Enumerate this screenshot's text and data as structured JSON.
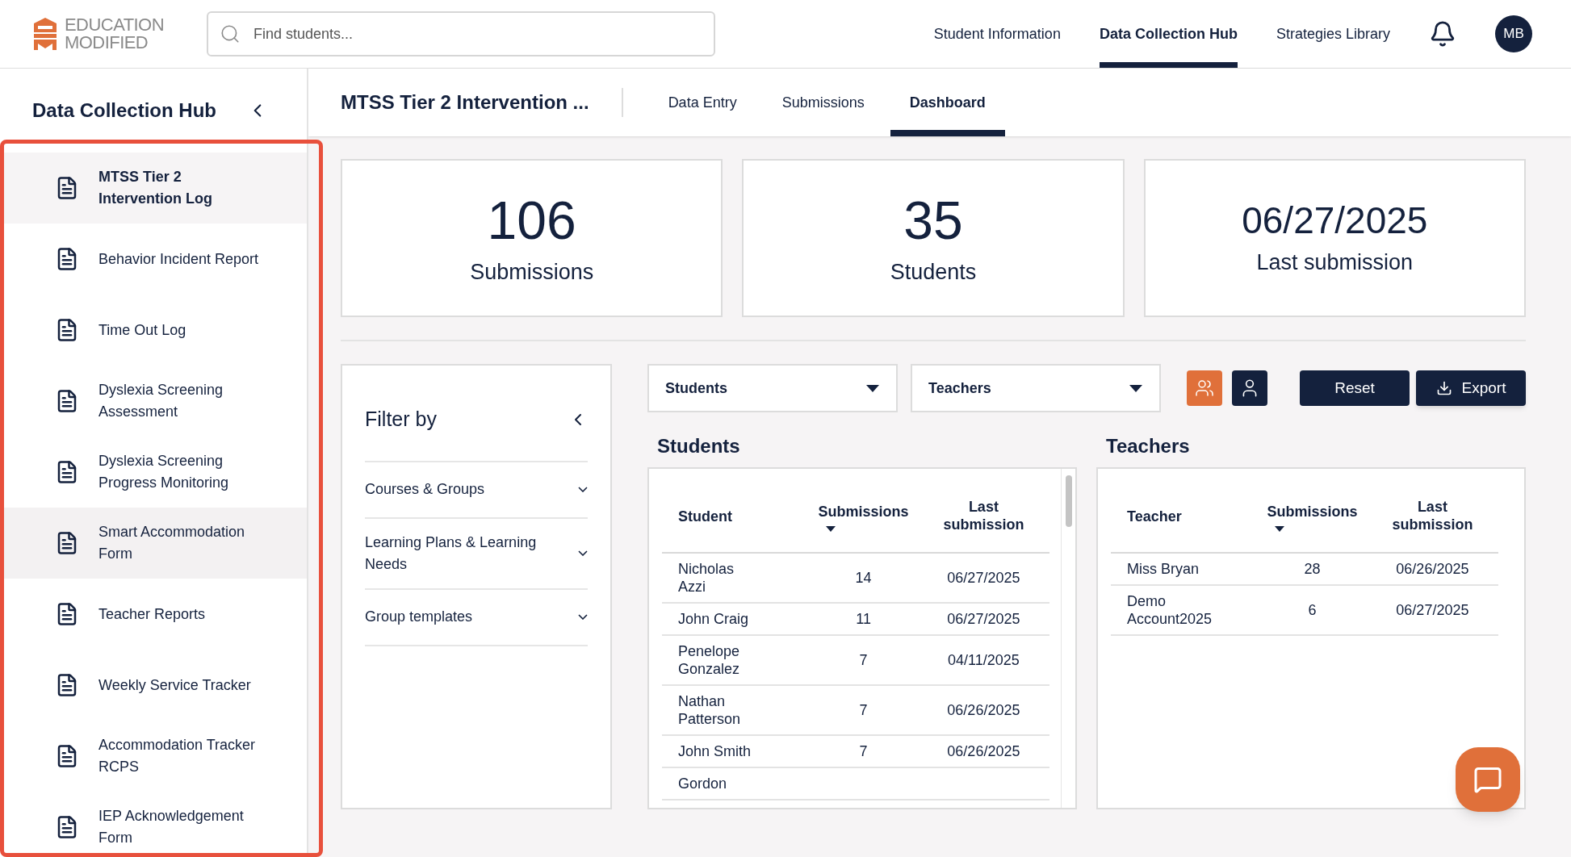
{
  "header": {
    "logo": {
      "line1": "EDUCATION",
      "line2": "MODIFIED"
    },
    "search": {
      "placeholder": "Find students..."
    },
    "nav": [
      {
        "label": "Student Information",
        "selected": false
      },
      {
        "label": "Data Collection Hub",
        "selected": true
      },
      {
        "label": "Strategies Library",
        "selected": false
      }
    ],
    "avatar": "MB"
  },
  "sidebar": {
    "title": "Data Collection Hub",
    "items": [
      {
        "label": "MTSS Tier 2 Intervention Log",
        "selected": true,
        "highlighted": false
      },
      {
        "label": "Behavior Incident Report",
        "selected": false,
        "highlighted": false
      },
      {
        "label": "Time Out Log",
        "selected": false,
        "highlighted": false
      },
      {
        "label": "Dyslexia Screening Assessment",
        "selected": false,
        "highlighted": false
      },
      {
        "label": "Dyslexia Screening Progress Monitoring",
        "selected": false,
        "highlighted": false
      },
      {
        "label": "Smart Accommodation Form",
        "selected": false,
        "highlighted": true
      },
      {
        "label": "Teacher Reports",
        "selected": false,
        "highlighted": false
      },
      {
        "label": "Weekly Service Tracker",
        "selected": false,
        "highlighted": false
      },
      {
        "label": "Accommodation Tracker RCPS",
        "selected": false,
        "highlighted": false
      },
      {
        "label": "IEP Acknowledgement Form",
        "selected": false,
        "highlighted": false
      }
    ]
  },
  "page": {
    "title": "MTSS Tier 2 Intervention ...",
    "tabs": [
      {
        "label": "Data Entry",
        "selected": false
      },
      {
        "label": "Submissions",
        "selected": false
      },
      {
        "label": "Dashboard",
        "selected": true
      }
    ]
  },
  "stats": [
    {
      "value": "106",
      "label": "Submissions",
      "kind": "big"
    },
    {
      "value": "35",
      "label": "Students",
      "kind": "big"
    },
    {
      "value": "06/27/2025",
      "label": "Last submission",
      "kind": "date"
    }
  ],
  "filter": {
    "title": "Filter by",
    "sections": [
      "Courses & Groups",
      "Learning Plans & Learning Needs",
      "Group templates"
    ]
  },
  "toolbar": {
    "dropdowns": [
      "Students",
      "Teachers"
    ],
    "views": [
      {
        "kind": "group",
        "selected": true
      },
      {
        "kind": "person",
        "selected": false
      }
    ],
    "reset": "Reset",
    "export": "Export"
  },
  "students": {
    "title": "Students",
    "columns": [
      "Student",
      "Submissions",
      "Last submission"
    ],
    "rows": [
      {
        "name": "Nicholas Azzi",
        "submissions": "14",
        "last": "06/27/2025"
      },
      {
        "name": "John Craig",
        "submissions": "11",
        "last": "06/27/2025"
      },
      {
        "name": "Penelope Gonzalez",
        "submissions": "7",
        "last": "04/11/2025"
      },
      {
        "name": "Nathan Patterson",
        "submissions": "7",
        "last": "06/26/2025"
      },
      {
        "name": "John Smith",
        "submissions": "7",
        "last": "06/26/2025"
      },
      {
        "name": "Gordon"
      }
    ]
  },
  "teachers": {
    "title": "Teachers",
    "columns": [
      "Teacher",
      "Submissions",
      "Last submission"
    ],
    "rows": [
      {
        "name": "Miss Bryan",
        "submissions": "28",
        "last": "06/26/2025"
      },
      {
        "name": "Demo Account2025",
        "submissions": "6",
        "last": "06/27/2025"
      }
    ]
  }
}
